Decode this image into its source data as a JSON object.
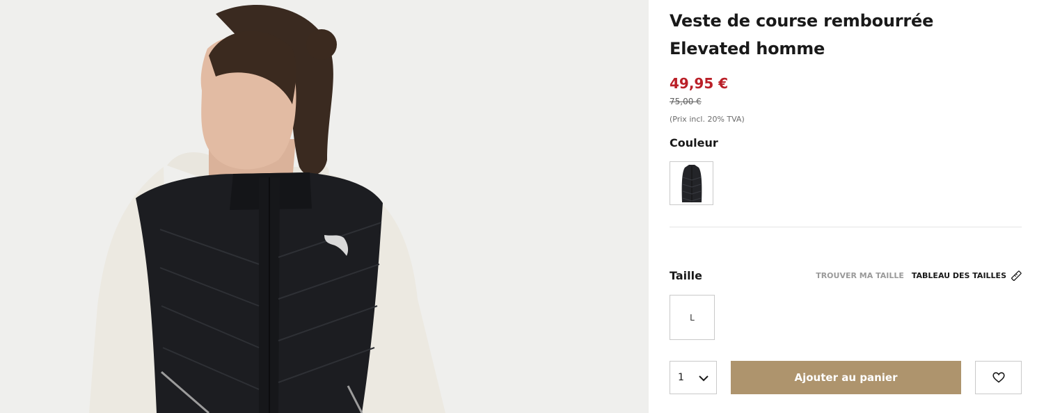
{
  "product": {
    "title": "Veste de course rembourrée Elevated homme",
    "price": "49,95 €",
    "old_price": "75,00 €",
    "tax_note": "(Prix incl. 20% TVA)",
    "price_color": "#ba2028",
    "brand_accent": "#ae946d"
  },
  "color_section": {
    "label": "Couleur",
    "swatches": [
      {
        "icon": "vest-thumbnail-icon",
        "selected": true
      }
    ]
  },
  "size_section": {
    "label": "Taille",
    "find_size_link": "TROUVER MA TAILLE",
    "size_chart_link": "TABLEAU DES TAILLES",
    "size_chart_icon": "ruler-icon",
    "sizes": [
      "L"
    ]
  },
  "purchase": {
    "quantity": "1",
    "quantity_icon": "chevron-down-icon",
    "add_to_cart_label": "Ajouter au panier",
    "wishlist_icon": "heart-icon"
  }
}
